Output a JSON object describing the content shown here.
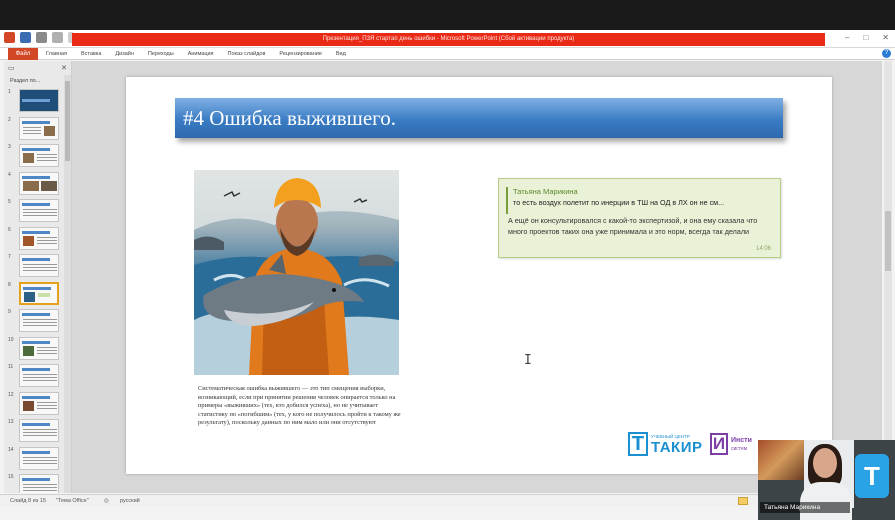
{
  "window": {
    "title": "Презентация_ПЗЯ стартап день ошибки - Microsoft PowerPoint (Сбой активации продукта)",
    "controls": [
      "–",
      "□",
      "✕"
    ]
  },
  "ribbon": {
    "file_tab": "Файл",
    "tabs": [
      "Главная",
      "Вставка",
      "Дизайн",
      "Переходы",
      "Анимация",
      "Показ слайдов",
      "Рецензирование",
      "Вид"
    ],
    "help": "?"
  },
  "thumbnails": {
    "section_label": "Раздел по...",
    "slides": [
      {
        "num": "1"
      },
      {
        "num": "2"
      },
      {
        "num": "3"
      },
      {
        "num": "4"
      },
      {
        "num": "5"
      },
      {
        "num": "6"
      },
      {
        "num": "7"
      },
      {
        "num": "8"
      },
      {
        "num": "9"
      },
      {
        "num": "10"
      },
      {
        "num": "11"
      },
      {
        "num": "12"
      },
      {
        "num": "13"
      },
      {
        "num": "14"
      },
      {
        "num": "15"
      }
    ],
    "selected": "8"
  },
  "slide": {
    "title": "#4 Ошибка выжившего.",
    "caption": "Систематическая ошибка выжившего — это тип смещения выборки, возникающий, если при принятии решения человек опирается только на примеры «выживших» (тех, кто добился успеха), но не учитывает статистику по «погибшим» (тех, у кого не получилось пройти к такому же результату), поскольку данных по ним мало или они отсутствуют",
    "message": {
      "sender": "Татьяна Марикина",
      "quoted": "то есть воздух полетит по инерции в ТШ на ОД в ЛХ он не см...",
      "body": "А ещё он консультировался с какой-то экспертизой, и она ему сказала что много проектов таких она уже принимала и это норм, всегда так делали",
      "time": "14:06"
    },
    "logos": {
      "takir_small": "УЧЕБНЫЙ ЦЕНТР",
      "takir_big": "ТАКИР",
      "takir_letter": "Т",
      "inst_letter": "И",
      "inst_word1": "Инсти",
      "inst_word2": "систем"
    }
  },
  "status": {
    "slide_info": "Слайд 8 из 15",
    "theme": "\"Тема Office\"",
    "lang": "русский"
  },
  "video": {
    "participant": "Татьяна Марикина",
    "logo_letter": "Т"
  },
  "colors": {
    "title_bar_red": "#e82a17",
    "file_tab": "#d24726",
    "banner_blue": "#3a7cc4",
    "message_bg": "#e9f2d6",
    "takir_blue": "#1a8fd1",
    "inst_purple": "#7b3fa6"
  }
}
